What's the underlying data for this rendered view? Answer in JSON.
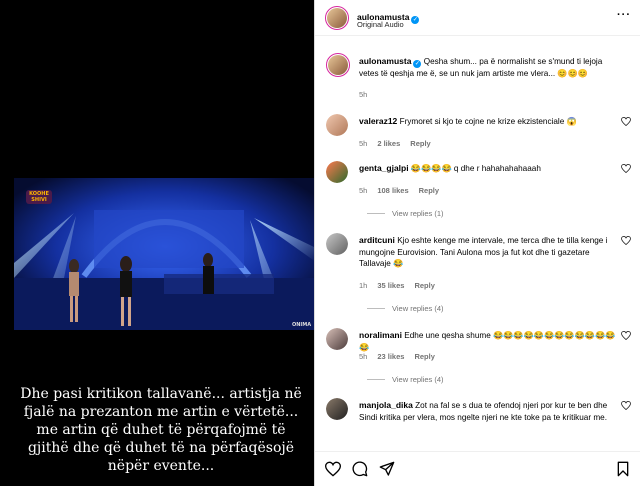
{
  "post": {
    "author": "aulonamusta",
    "audio": "Original Audio",
    "caption": "Qesha shum... pa ë normalisht se s'mund ti lejoja vetes të qeshja me ë, se un nuk jam artiste me vlera... 😊😊😊",
    "time": "5h"
  },
  "media": {
    "caption": "Dhe pasi kritikon tallavanë... artistja në fjalë na prezanton me artin e vërtetë... me artin që duhet të përqafojmë të gjithë dhe që duhet të na përfaqësojë nëpër evente...",
    "watermark": "ONIMA",
    "show_logo_line1": "KOOHE",
    "show_logo_line2": "SHIVI"
  },
  "comments": [
    {
      "user": "valeraz12",
      "text": "Frymoret si kjo te cojne ne krize ekzistenciale 😱",
      "time": "5h",
      "likes": "2 likes",
      "reply": "Reply",
      "replies": null
    },
    {
      "user": "genta_gjalpi",
      "text": "😂😂😂😂 q dhe r hahahahahaaah",
      "time": "5h",
      "likes": "108 likes",
      "reply": "Reply",
      "replies": "View replies (1)"
    },
    {
      "user": "arditcuni",
      "text": "Kjo eshte kenge me intervale, me terca dhe te tilla kenge i mungojne Eurovision. Tani Aulona mos ja fut kot dhe ti gazetare Tallavaje 😂",
      "time": "1h",
      "likes": "35 likes",
      "reply": "Reply",
      "replies": "View replies (4)"
    },
    {
      "user": "noralimani",
      "text": "Edhe une qesha shume 😂😂😂😂😂😂😂😂😂😂😂😂😂",
      "time": "5h",
      "likes": "23 likes",
      "reply": "Reply",
      "replies": "View replies (4)"
    },
    {
      "user": "manjola_dika",
      "text": "Zot na fal se s dua te ofendoj njeri por kur te ben dhe Sindi kritika per vlera, mos ngelte njeri ne kte toke pa te kritikuar me.",
      "time": "",
      "likes": "",
      "reply": "",
      "replies": null
    }
  ],
  "icons": [
    "heart-icon",
    "comment-icon",
    "share-icon",
    "bookmark-icon",
    "more-icon",
    "verified-icon"
  ],
  "colors": {
    "verified": "#0095f6",
    "muted": "#737373",
    "story_ring": "#d6249f"
  }
}
